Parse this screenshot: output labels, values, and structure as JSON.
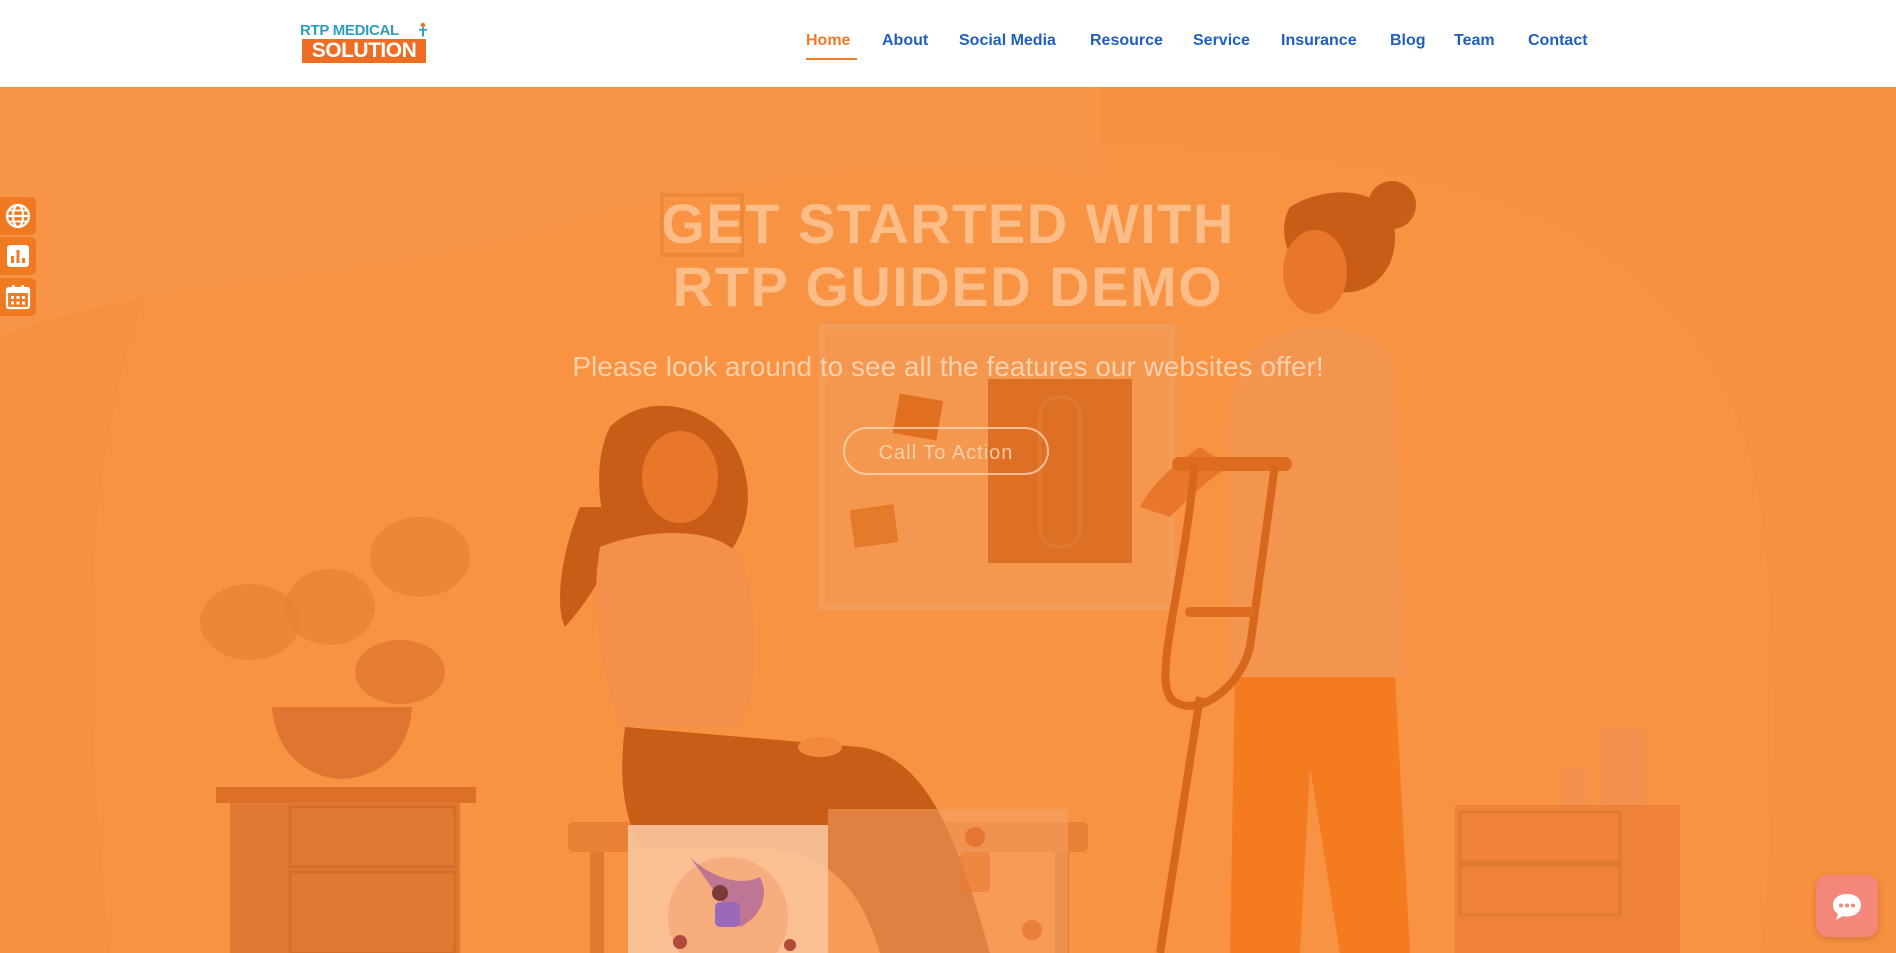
{
  "logo": {
    "line1": "RTP MEDICAL",
    "line2": "SOLUTION"
  },
  "nav": {
    "items": [
      {
        "label": "Home"
      },
      {
        "label": "About"
      },
      {
        "label": "Social Media"
      },
      {
        "label": "Resource"
      },
      {
        "label": "Service"
      },
      {
        "label": "Insurance"
      },
      {
        "label": "Blog"
      },
      {
        "label": "Team"
      },
      {
        "label": "Contact"
      }
    ],
    "active": "Home"
  },
  "hero": {
    "headline_line1": "GET STARTED WITH",
    "headline_line2": "RTP GUIDED DEMO",
    "subline": "Please look around to see all the features our websites offer!",
    "cta_label": "Call To Action"
  },
  "side_toolbar": {
    "icons": [
      "globe-icon",
      "chart-icon",
      "calendar-icon"
    ]
  },
  "chat": {
    "icon": "chat-icon"
  },
  "colors": {
    "accent": "#ef7a2a",
    "nav_text": "#1f5fbf",
    "hero_bg": "#f8913f",
    "chat_bg": "#f3877a"
  }
}
